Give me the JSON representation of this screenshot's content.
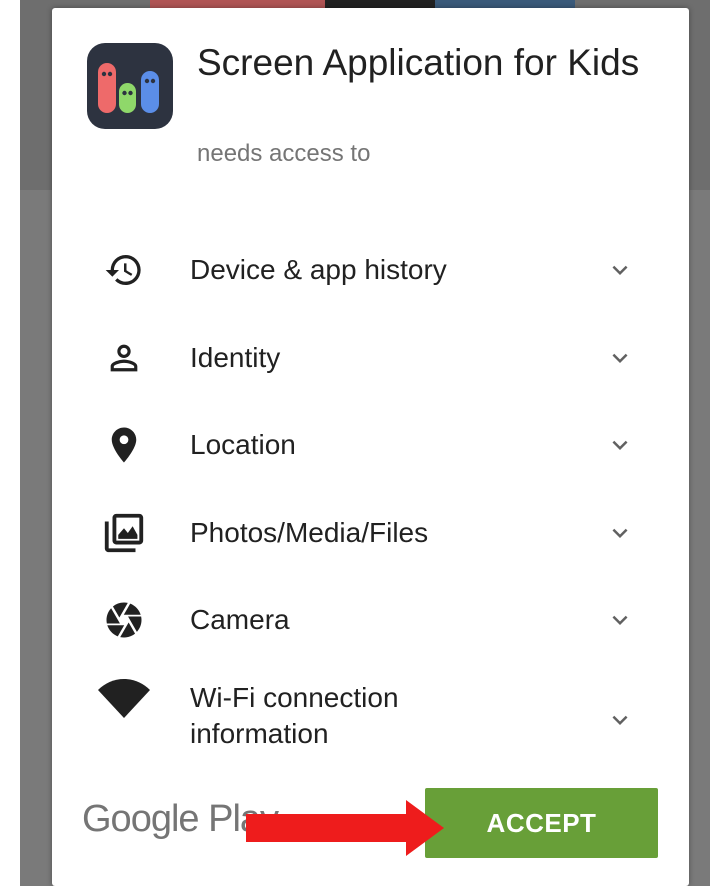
{
  "dialog": {
    "app_name": "Screen Application for Kids",
    "subtitle": "needs access to",
    "icon": "app-icon-three-ghosts"
  },
  "permissions": [
    {
      "label": "Device & app history",
      "icon": "history-icon"
    },
    {
      "label": "Identity",
      "icon": "person-icon"
    },
    {
      "label": "Location",
      "icon": "location-pin-icon"
    },
    {
      "label": "Photos/Media/Files",
      "icon": "photo-library-icon"
    },
    {
      "label": "Camera",
      "icon": "camera-aperture-icon"
    },
    {
      "label": "Wi-Fi connection information",
      "icon": "wifi-icon"
    }
  ],
  "footer": {
    "brand": "Google Play",
    "accept_label": "ACCEPT"
  },
  "colors": {
    "accept_green": "#689f38",
    "arrow_red": "#ee1c1c",
    "text_primary": "#212121",
    "text_secondary": "#757575"
  }
}
